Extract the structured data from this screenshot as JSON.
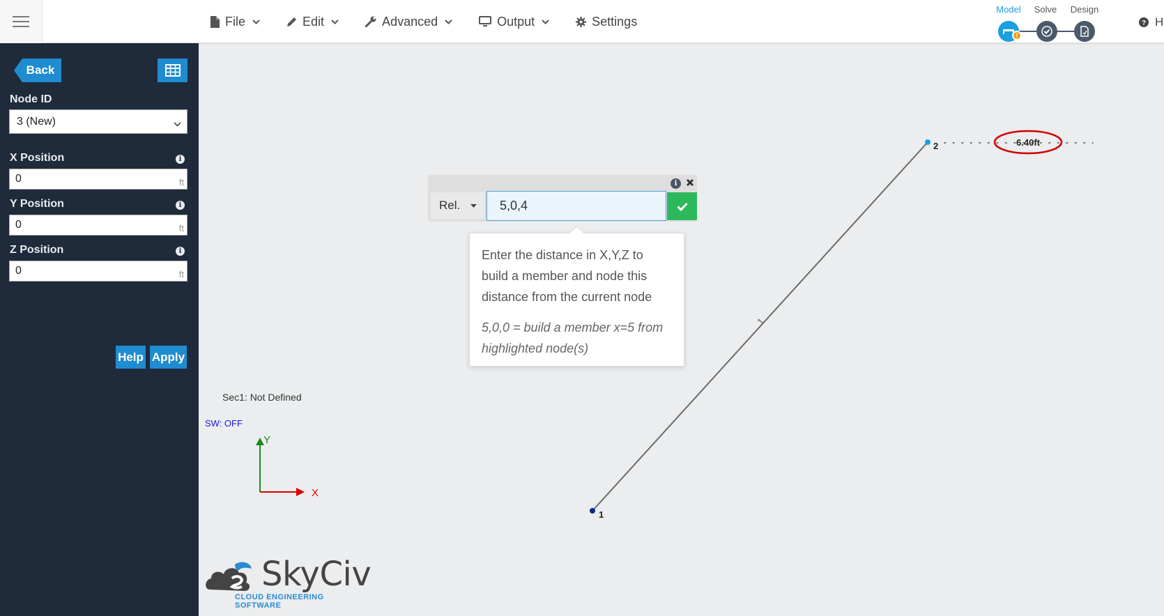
{
  "header": {
    "menu": [
      {
        "label": "File",
        "icon": "file-icon"
      },
      {
        "label": "Edit",
        "icon": "pencil-icon"
      },
      {
        "label": "Advanced",
        "icon": "wrench-icon"
      },
      {
        "label": "Output",
        "icon": "monitor-icon"
      },
      {
        "label": "Settings",
        "icon": "gear-icon"
      }
    ],
    "steps": [
      {
        "label": "Model",
        "state": "active",
        "color": "#1a9fe0"
      },
      {
        "label": "Solve",
        "state": "pending",
        "color": "#4a5a6b"
      },
      {
        "label": "Design",
        "state": "pending",
        "color": "#4a5a6b"
      }
    ],
    "help_label": "H",
    "warning_badge": "!"
  },
  "sidebar": {
    "back_label": "Back",
    "table_icon": "table-icon",
    "node_id_label": "Node ID",
    "node_id_value": "3 (New)",
    "x_label": "X Position",
    "x_value": "0",
    "y_label": "Y Position",
    "y_value": "0",
    "z_label": "Z Position",
    "z_value": "0",
    "unit": "ft",
    "help_button": "Help",
    "apply_button": "Apply"
  },
  "canvas": {
    "section_text": "Sec1: Not Defined",
    "sw_text": "SW: OFF",
    "axis_x_label": "X",
    "axis_y_label": "Y",
    "node_1_label": "1",
    "node_2_label": "2",
    "member_label": "1",
    "dimension_label": "6.40ft"
  },
  "command": {
    "mode_label": "Rel.",
    "input_value": "5,0,4",
    "tooltip_main": "Enter the distance in X,Y,Z to build a member and node this distance from the current node",
    "tooltip_example": "5,0,0 = build a member x=5 from highlighted node(s)"
  },
  "logo": {
    "name": "SkyCiv",
    "tagline": "CLOUD ENGINEERING SOFTWARE"
  },
  "colors": {
    "accent": "#1f8cd0",
    "sidebar_bg": "#1f2a3a",
    "ok_green": "#2eb85c",
    "highlight_red": "#d00000"
  }
}
